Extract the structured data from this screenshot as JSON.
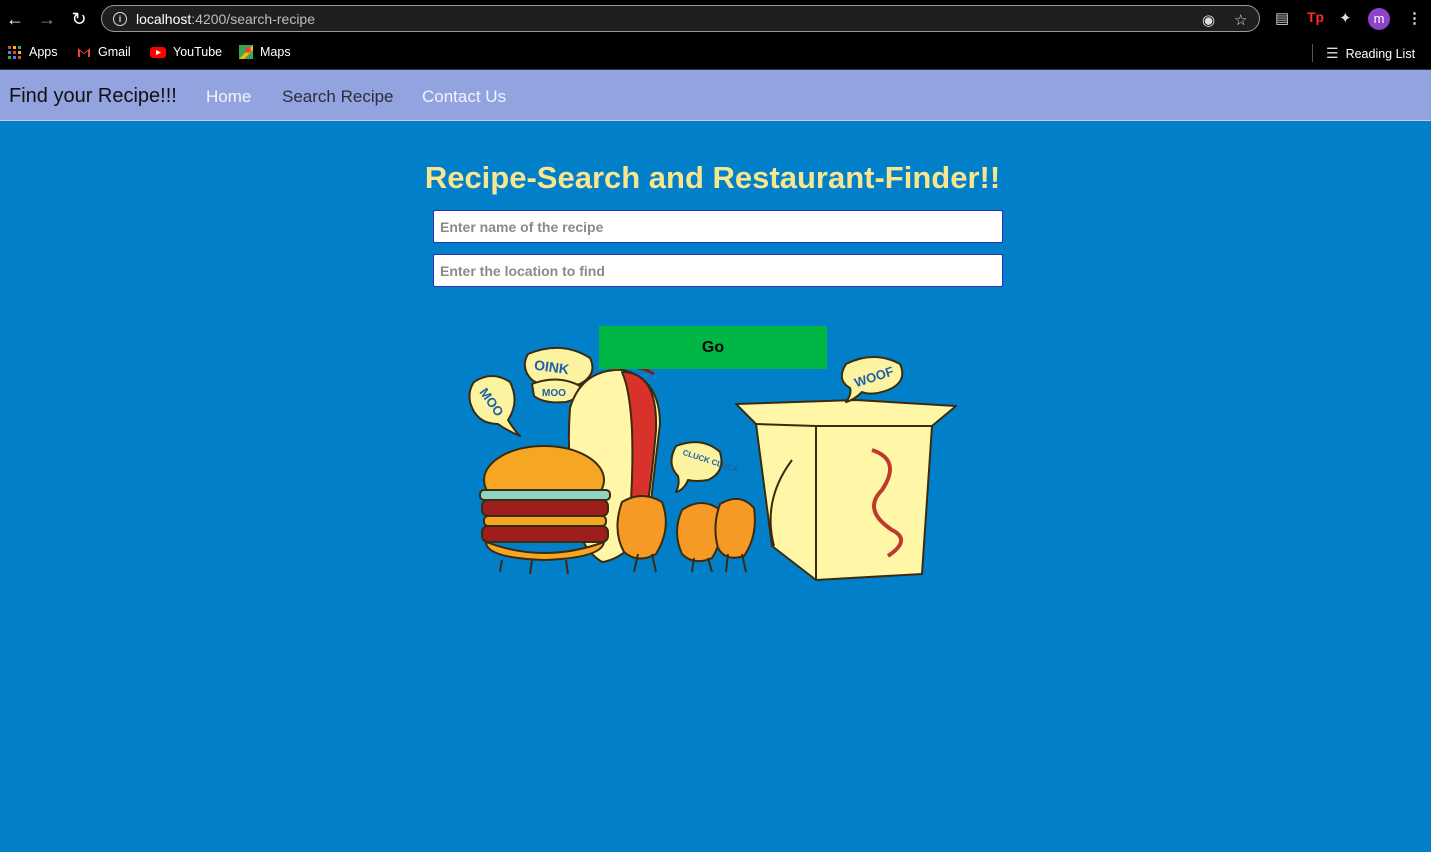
{
  "browser": {
    "url_host": "localhost",
    "url_path": ":4200/search-recipe",
    "profile_initial": "m",
    "bookmarks": [
      {
        "label": "Apps"
      },
      {
        "label": "Gmail"
      },
      {
        "label": "YouTube"
      },
      {
        "label": "Maps"
      }
    ],
    "reading_list": "Reading List"
  },
  "navbar": {
    "brand": "Find your Recipe!!!",
    "links": [
      {
        "label": "Home"
      },
      {
        "label": "Search Recipe"
      },
      {
        "label": "Contact Us"
      }
    ]
  },
  "main": {
    "heading": "Recipe-Search and Restaurant-Finder!!",
    "recipe_placeholder": "Enter name of the recipe",
    "location_placeholder": "Enter the location to find",
    "go_label": "Go",
    "illustration_words": [
      "OINK",
      "MOO",
      "MOO",
      "CLUCK CLUCK",
      "WOOF"
    ]
  },
  "colors": {
    "page_bg": "#0180c9",
    "navbar_bg": "#93a3e0",
    "heading": "#f7e58f",
    "go_button": "#00b746"
  }
}
